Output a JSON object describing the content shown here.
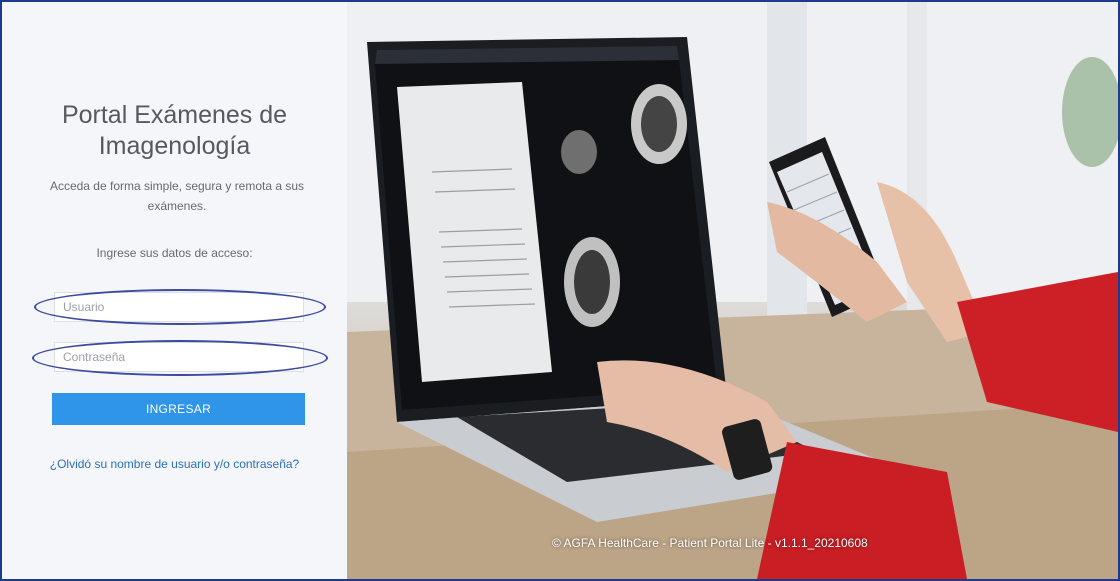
{
  "login": {
    "title_line1": "Portal Exámenes de",
    "title_line2": "Imagenología",
    "subtitle": "Acceda de forma simple, segura y remota a sus exámenes.",
    "prompt": "Ingrese sus datos de acceso:",
    "username_placeholder": "Usuario",
    "password_placeholder": "Contraseña",
    "submit_label": "INGRESAR",
    "forgot_link": "¿Olvidó su nombre de usuario y/o contraseña?"
  },
  "hero": {
    "footer": "© AGFA HealthCare - Patient Portal Lite - v1.1.1_20210608"
  },
  "colors": {
    "primary_button": "#2f95e8",
    "link": "#2c6fb8",
    "annotation_ellipse": "#3c4aa0",
    "frame_border": "#1f3a8a"
  }
}
